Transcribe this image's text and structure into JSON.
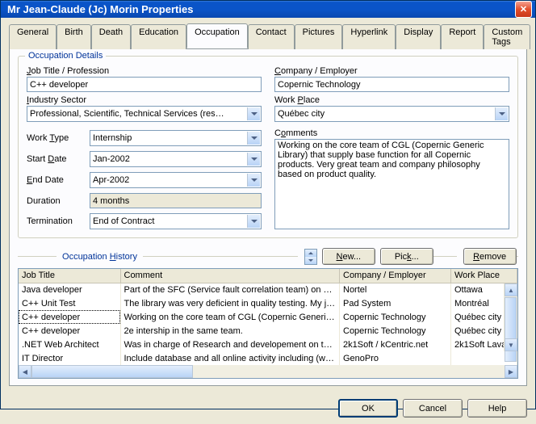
{
  "window": {
    "title": "Mr Jean-Claude (Jc) Morin Properties"
  },
  "tabs": [
    "General",
    "Birth",
    "Death",
    "Education",
    "Occupation",
    "Contact",
    "Pictures",
    "Hyperlink",
    "Display",
    "Report",
    "Custom Tags"
  ],
  "active_tab": 4,
  "details": {
    "legend": "Occupation Details",
    "job_title_label": "Job Title / Profession",
    "job_title": "C++ developer",
    "company_label": "Company / Employer",
    "company": "Copernic Technology",
    "industry_label": "Industry Sector",
    "industry": "Professional, Scientific, Technical Services (res…",
    "workplace_label": "Work Place",
    "workplace": "Québec city",
    "worktype_label_html": "Work Type",
    "worktype": "Internship",
    "startdate_label": "Start Date",
    "startdate": "Jan-2002",
    "enddate_label": "End Date",
    "enddate": "Apr-2002",
    "duration_label": "Duration",
    "duration": "4 months",
    "termination_label": "Termination",
    "termination": "End of Contract",
    "comments_label": "Comments",
    "comments": "Working on the core team of CGL (Copernic Generic Library) that supply base function for all Copernic products. Very great team and company philosophy based on product quality."
  },
  "history": {
    "legend": "Occupation History",
    "new_btn": "New...",
    "pick_btn": "Pick...",
    "remove_btn": "Remove",
    "cols": [
      "Job Title",
      "Comment",
      "Company / Employer",
      "Work Place"
    ],
    "rows": [
      {
        "title": "Java developer",
        "comment": "Part of the SFC (Service fault correlation team) on optical f…",
        "company": "Nortel",
        "place": "Ottawa"
      },
      {
        "title": "C++ Unit Test",
        "comment": "The library was very deficient in quality testing. My job wa…",
        "company": "Pad System",
        "place": "Montréal"
      },
      {
        "title": "C++ developer",
        "comment": "Working on the core team of CGL (Copernic Generic Librar…",
        "company": "Copernic Technology",
        "place": "Québec city"
      },
      {
        "title": "C++ developer",
        "comment": "2e intership in the same team.",
        "company": "Copernic Technology",
        "place": "Québec city"
      },
      {
        "title": ".NET Web Architect",
        "comment": "Was in charge of Research and developement on the e-co…",
        "company": "2k1Soft / kCentric.net",
        "place": "2k1Soft Lava"
      },
      {
        "title": "IT Director",
        "comment": "Include database and all online activity including (web ser…",
        "company": "GenoPro",
        "place": ""
      }
    ],
    "selected_row": 2
  },
  "footer": {
    "ok": "OK",
    "cancel": "Cancel",
    "help": "Help"
  }
}
